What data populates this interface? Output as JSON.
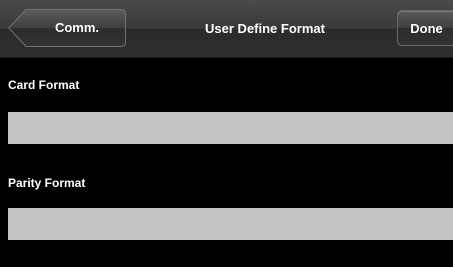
{
  "header": {
    "back_label": "Comm.",
    "title": "User Define Format",
    "done_label": "Done"
  },
  "fields": [
    {
      "label": "Card Format",
      "value": ""
    },
    {
      "label": "Parity Format",
      "value": ""
    }
  ],
  "colors": {
    "background": "#000000",
    "header": "#333333",
    "input_fill": "#c4c4c4",
    "text": "#ffffff"
  },
  "icons": {
    "back": "back-arrow-icon"
  }
}
